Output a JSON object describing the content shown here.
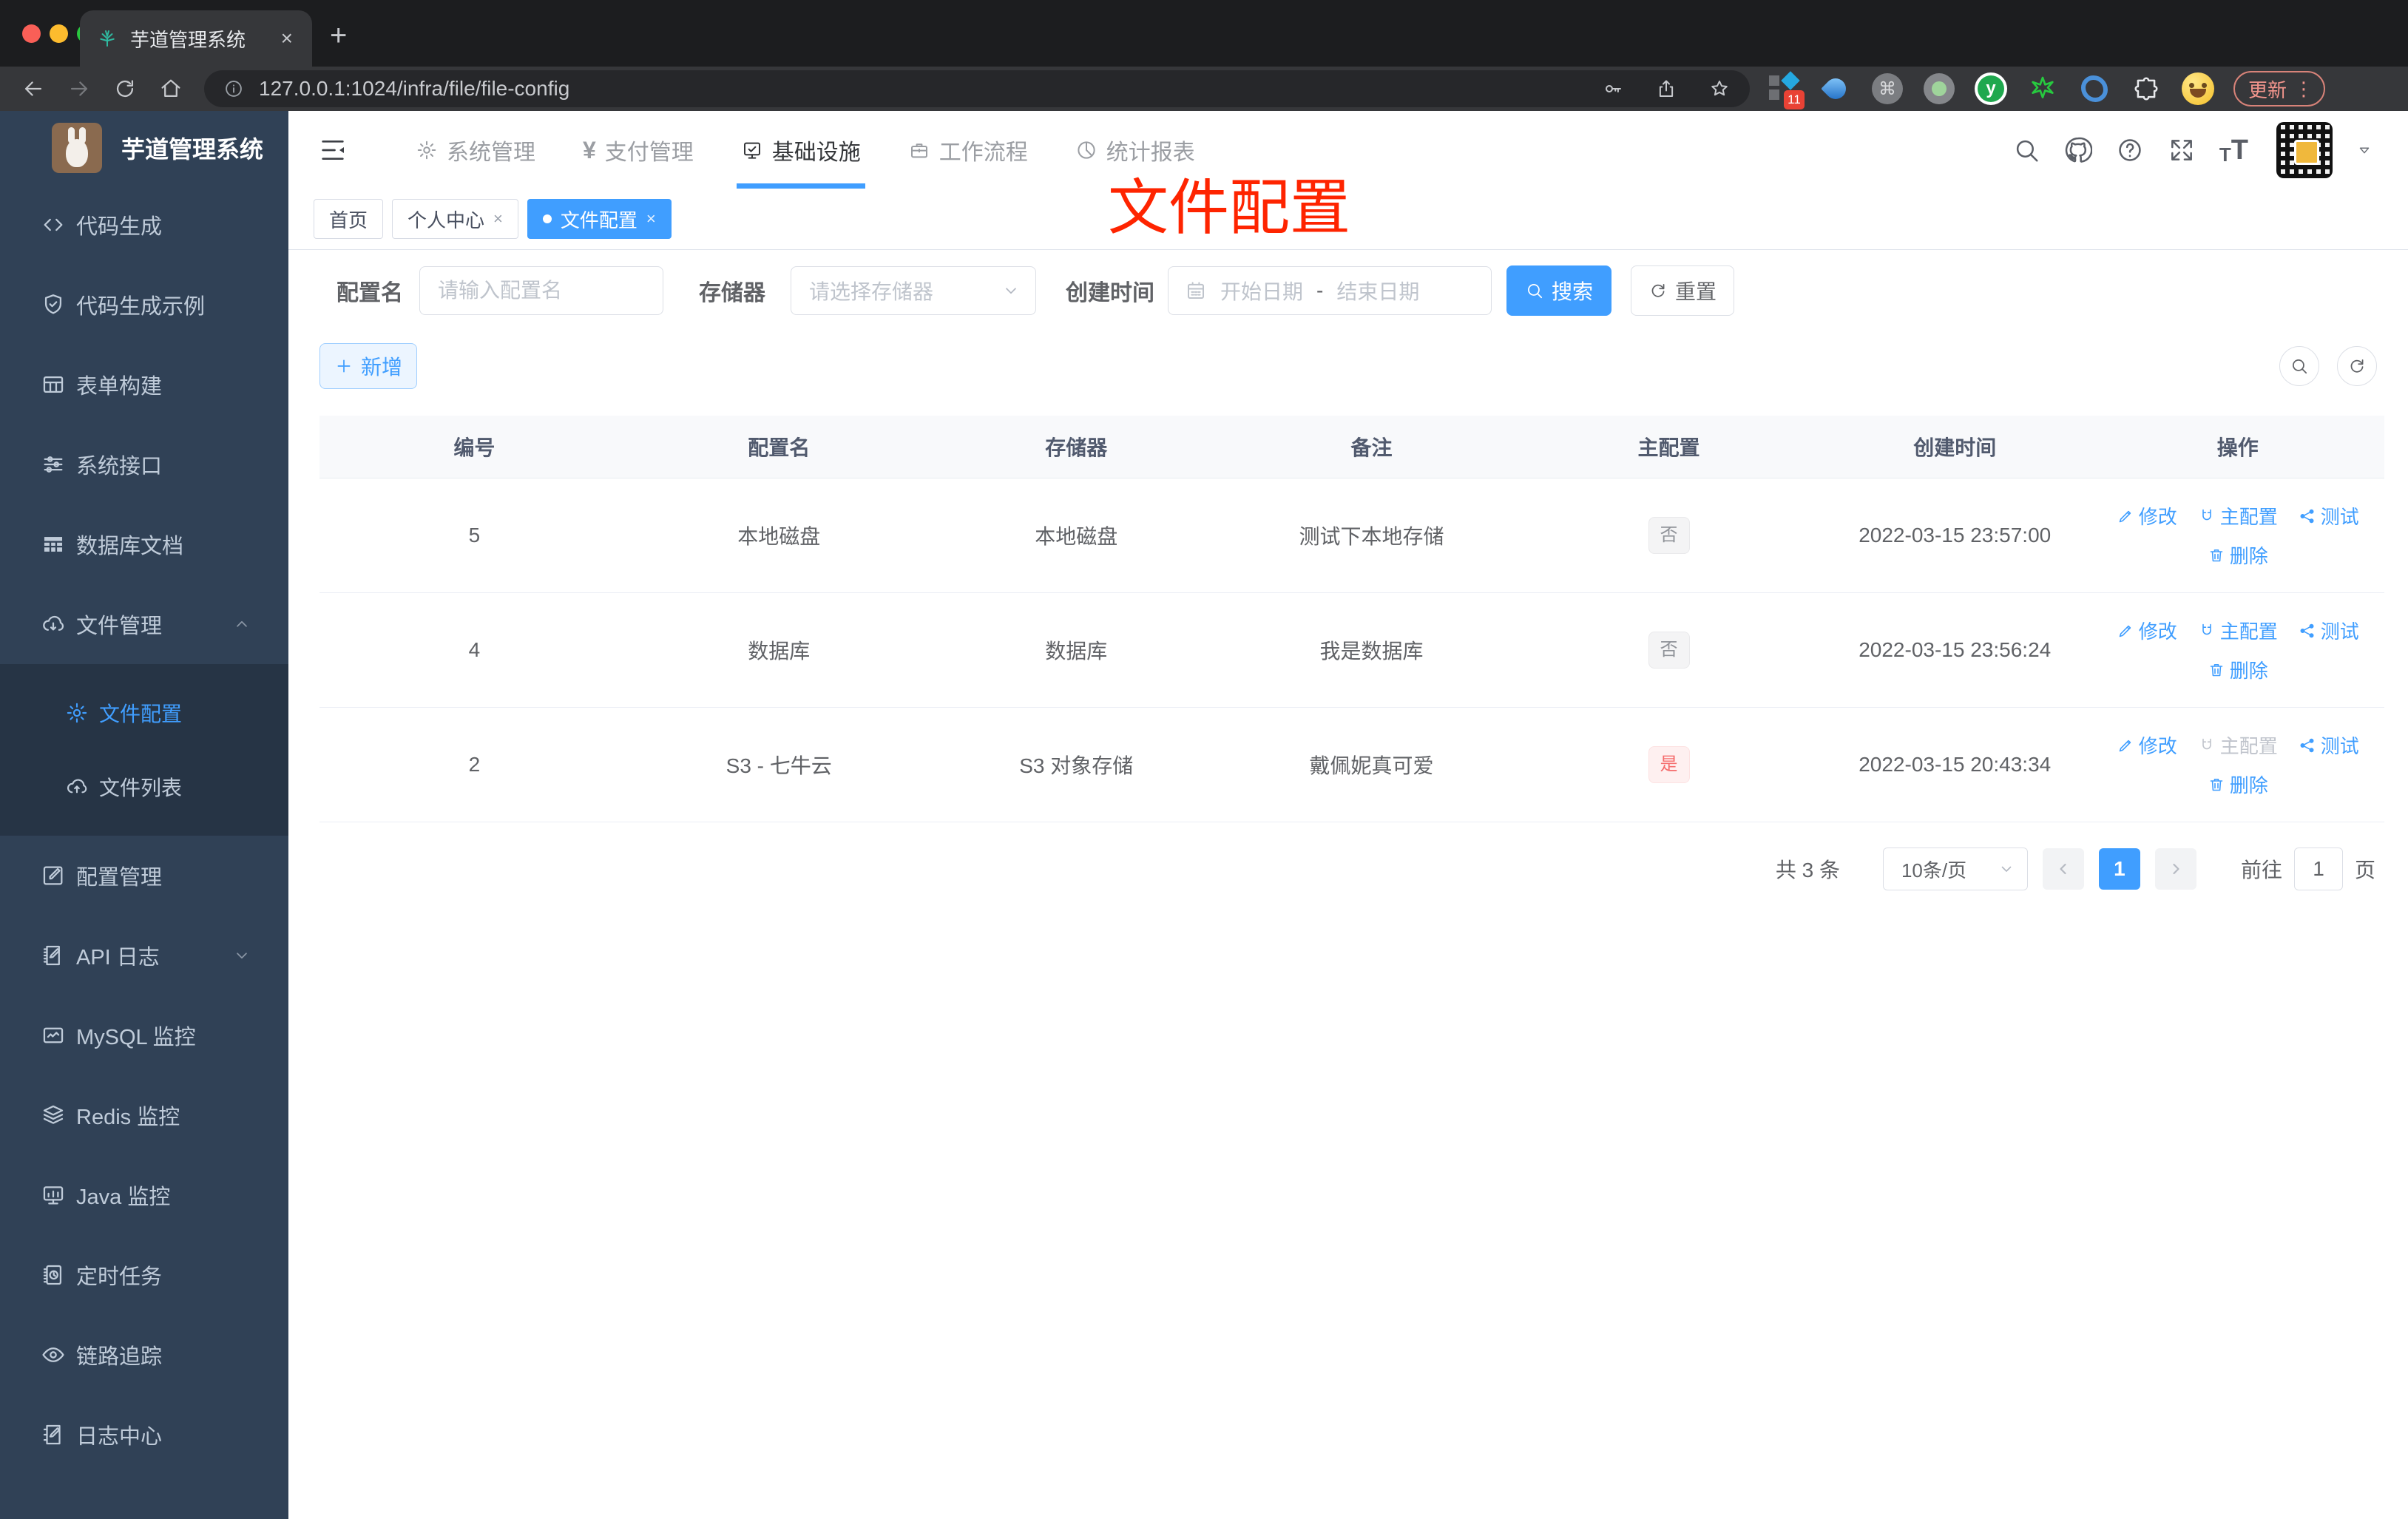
{
  "browser": {
    "tab_title": "芋道管理系统",
    "url": "127.0.0.1:1024/infra/file/file-config",
    "extension_badge": "11",
    "update_label": "更新"
  },
  "sidebar": {
    "app_title": "芋道管理系统",
    "menu": [
      {
        "label": "代码生成"
      },
      {
        "label": "代码生成示例"
      },
      {
        "label": "表单构建"
      },
      {
        "label": "系统接口"
      },
      {
        "label": "数据库文档"
      },
      {
        "label": "文件管理"
      },
      {
        "label": "文件配置"
      },
      {
        "label": "文件列表"
      },
      {
        "label": "配置管理"
      },
      {
        "label": "API 日志"
      },
      {
        "label": "MySQL 监控"
      },
      {
        "label": "Redis 监控"
      },
      {
        "label": "Java 监控"
      },
      {
        "label": "定时任务"
      },
      {
        "label": "链路追踪"
      },
      {
        "label": "日志中心"
      }
    ]
  },
  "topnav": {
    "items": [
      {
        "label": "系统管理"
      },
      {
        "label": "支付管理"
      },
      {
        "label": "基础设施"
      },
      {
        "label": "工作流程"
      },
      {
        "label": "统计报表"
      }
    ]
  },
  "tabs": [
    {
      "label": "首页"
    },
    {
      "label": "个人中心"
    },
    {
      "label": "文件配置"
    }
  ],
  "annotation": {
    "text": "文件配置"
  },
  "filters": {
    "name_label": "配置名",
    "name_placeholder": "请输入配置名",
    "storage_label": "存储器",
    "storage_placeholder": "请选择存储器",
    "time_label": "创建时间",
    "start_placeholder": "开始日期",
    "range_separator": "-",
    "end_placeholder": "结束日期",
    "search_label": "搜索",
    "reset_label": "重置"
  },
  "toolbar": {
    "add_label": "新增"
  },
  "table": {
    "columns": [
      "编号",
      "配置名",
      "存储器",
      "备注",
      "主配置",
      "创建时间",
      "操作"
    ],
    "action_labels": {
      "edit": "修改",
      "master": "主配置",
      "test": "测试",
      "delete": "删除"
    },
    "rows": [
      {
        "id": "5",
        "name": "本地磁盘",
        "storage": "本地磁盘",
        "remark": "测试下本地存储",
        "master": "否",
        "created": "2022-03-15 23:57:00"
      },
      {
        "id": "4",
        "name": "数据库",
        "storage": "数据库",
        "remark": "我是数据库",
        "master": "否",
        "created": "2022-03-15 23:56:24"
      },
      {
        "id": "2",
        "name": "S3 - 七牛云",
        "storage": "S3 对象存储",
        "remark": "戴佩妮真可爱",
        "master": "是",
        "created": "2022-03-15 20:43:34"
      }
    ]
  },
  "pagination": {
    "total": "共 3 条",
    "page_size": "10条/页",
    "current_page": "1",
    "goto_label": "前往",
    "goto_value": "1",
    "page_unit": "页"
  },
  "colors": {
    "accent": "#409eff",
    "danger": "#f56c6c",
    "sidebar_bg": "#304156",
    "submenu_bg": "#263445",
    "annotation_red": "#fe2400"
  }
}
